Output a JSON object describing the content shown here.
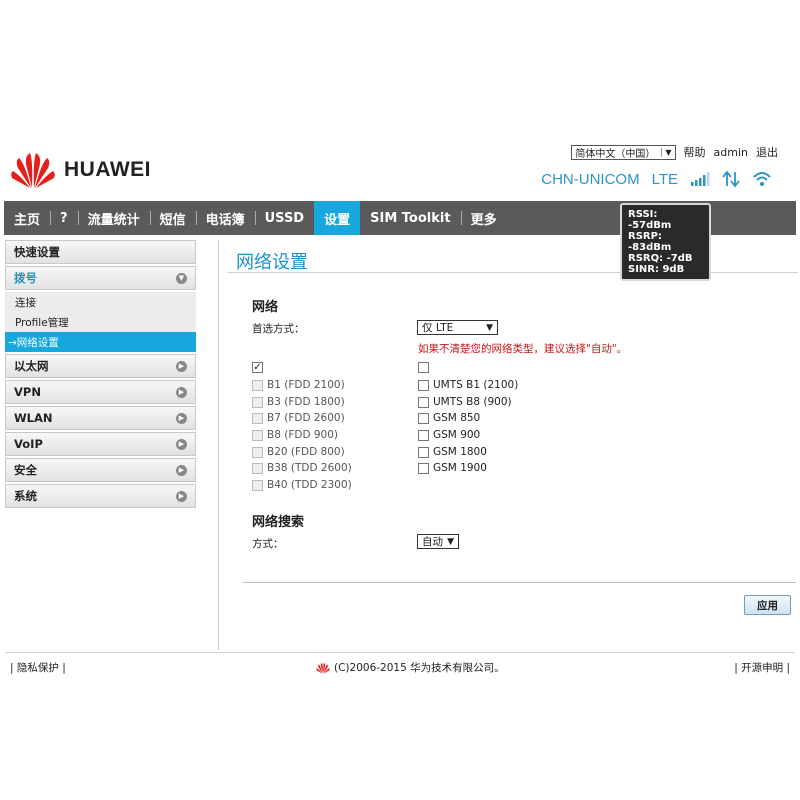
{
  "header": {
    "language": "简体中文（中国）",
    "help": "帮助",
    "user": "admin",
    "logout": "退出",
    "brand": "HUAWEI",
    "carrier": "CHN-UNICOM",
    "network_type": "LTE"
  },
  "signal": {
    "rssi": "RSSI: -57dBm",
    "rsrp": "RSRP: -83dBm",
    "rsrq": "RSRQ: -7dB",
    "sinr": "SINR: 9dB"
  },
  "nav": [
    "主页",
    "?",
    "流量统计",
    "短信",
    "电话簿",
    "USSD",
    "设置",
    "SIM Toolkit",
    "更多"
  ],
  "sidebar": {
    "quick_setup": "快速设置",
    "dial": "拨号",
    "dial_items": [
      "连接",
      "Profile管理",
      "→网络设置"
    ],
    "groups": [
      "以太网",
      "VPN",
      "WLAN",
      "VoIP",
      "安全",
      "系统"
    ]
  },
  "main": {
    "title": "网络设置",
    "network_section": "网络",
    "preferred_mode_label": "首选方式：",
    "preferred_mode_value": "仅 LTE",
    "hint": "如果不清楚您的网络类型，建议选择\"自动\"。",
    "lte_check": "✓",
    "lte_bands": [
      "B1 (FDD 2100)",
      "B3 (FDD 1800)",
      "B7 (FDD 2600)",
      "B8 (FDD 900)",
      "B20 (FDD 800)",
      "B38 (TDD 2600)",
      "B40 (TDD 2300)"
    ],
    "other_bands": [
      "UMTS B1 (2100)",
      "UMTS B8 (900)",
      "GSM 850",
      "GSM 900",
      "GSM 1800",
      "GSM 1900"
    ],
    "search_section": "网络搜索",
    "search_mode_label": "方式：",
    "search_mode_value": "自动",
    "apply": "应用"
  },
  "footer": {
    "privacy": "隐私保护",
    "copyright": "(C)2006-2015 华为技术有限公司。",
    "open_source": "开源申明"
  },
  "colors": {
    "accent": "#16a8dd",
    "nav_bg": "#5a5a5a",
    "hint": "#c81818",
    "brand_red": "#e4201d"
  }
}
